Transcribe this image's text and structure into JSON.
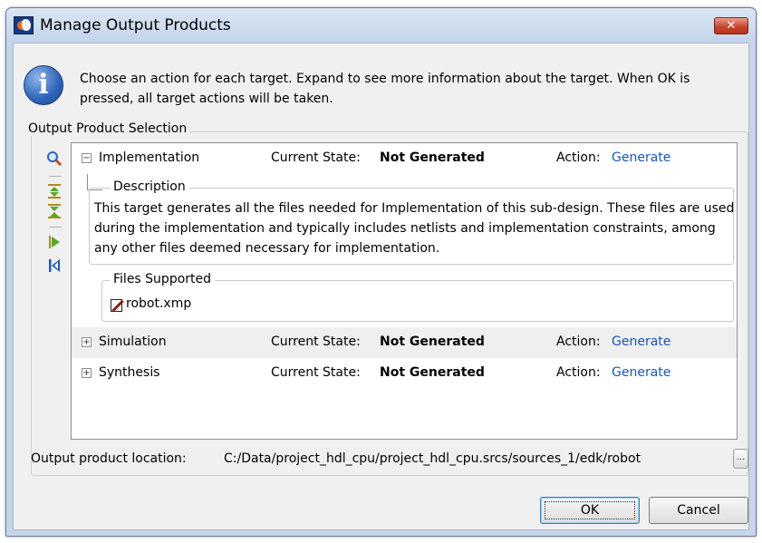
{
  "window": {
    "title": "Manage Output Products",
    "close_label": "✕"
  },
  "intro": {
    "text": "Choose an action for each target. Expand to see more information about the target. When OK is pressed, all target actions will be taken."
  },
  "group": {
    "label": "Output Product Selection"
  },
  "toolbar": {
    "icons": [
      "search-icon",
      "expand-all-icon",
      "collapse-all-icon",
      "next-icon",
      "first-icon"
    ]
  },
  "targets": [
    {
      "name": "Implementation",
      "expander": "−",
      "state_label": "Current State:",
      "state": "Not Generated",
      "action_label": "Action:",
      "action": "Generate"
    },
    {
      "name": "Simulation",
      "expander": "+",
      "state_label": "Current State:",
      "state": "Not Generated",
      "action_label": "Action:",
      "action": "Generate"
    },
    {
      "name": "Synthesis",
      "expander": "+",
      "state_label": "Current State:",
      "state": "Not Generated",
      "action_label": "Action:",
      "action": "Generate"
    }
  ],
  "details": {
    "description_label": "Description",
    "description": "This target generates all the files needed for Implementation of this sub-design.  These files are used during the implementation and typically includes netlists and implementation constraints, among any other files deemed necessary for implementation.",
    "files_label": "Files Supported",
    "file": "robot.xmp"
  },
  "location": {
    "label": "Output product location:",
    "value": "C:/Data/project_hdl_cpu/project_hdl_cpu.srcs/sources_1/edk/robot",
    "browse_label": "..."
  },
  "buttons": {
    "ok": "OK",
    "cancel": "Cancel"
  }
}
